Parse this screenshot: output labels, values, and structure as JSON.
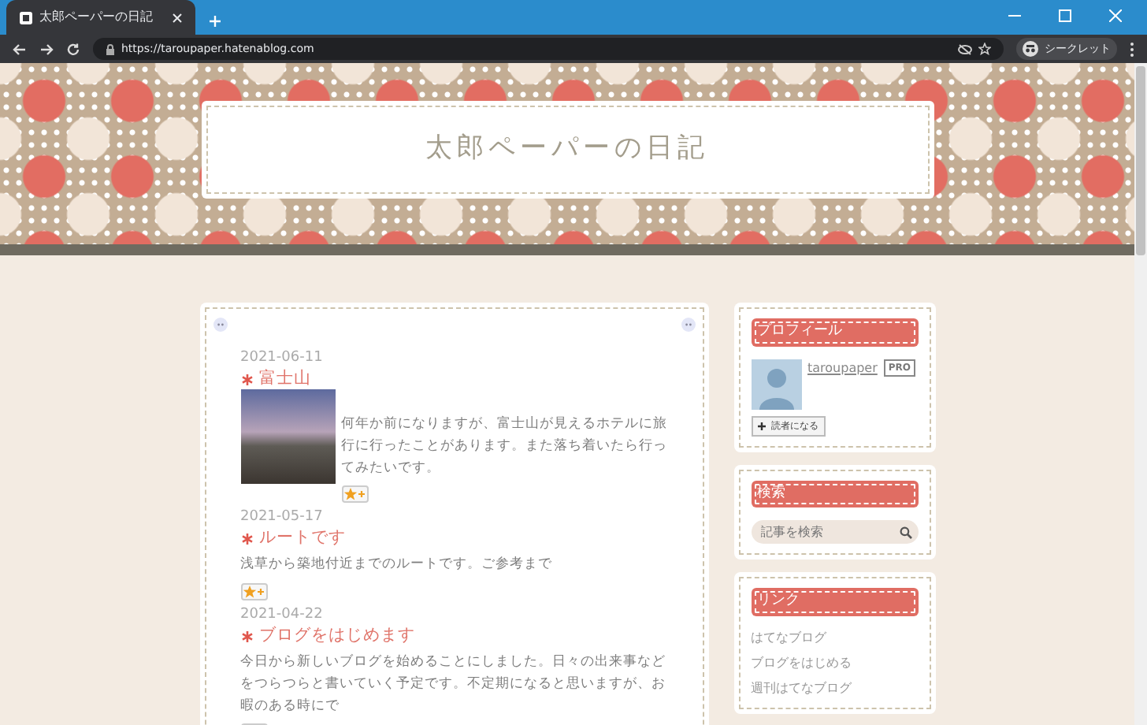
{
  "browser": {
    "tab_title": "太郎ペーパーの日記",
    "url": "https://taroupaper.hatenablog.com",
    "incognito_label": "シークレット"
  },
  "blog": {
    "title": "太郎ペーパーの日記"
  },
  "entries": [
    {
      "date": "2021-06-11",
      "title": "富士山",
      "has_photo": true,
      "body": "何年か前になりますが、富士山が見えるホテルに旅行に行ったことがあります。また落ち着いたら行ってみたいです。"
    },
    {
      "date": "2021-05-17",
      "title": "ルートです",
      "has_photo": false,
      "body": "浅草から築地付近までのルートです。ご参考まで"
    },
    {
      "date": "2021-04-22",
      "title": "ブログをはじめます",
      "has_photo": false,
      "body": "今日から新しいブログを始めることにしました。日々の出来事などをつらつらと書いていく予定です。不定期になると思いますが、お暇のある時にで"
    }
  ],
  "sidebar": {
    "profile": {
      "heading": "プロフィール",
      "username": "taroupaper",
      "badge": "PRO",
      "subscribe_button": "読者になる"
    },
    "search": {
      "heading": "検索",
      "placeholder": "記事を検索"
    },
    "links": {
      "heading": "リンク",
      "items": [
        "はてなブログ",
        "ブログをはじめる",
        "週刊はてなブログ"
      ]
    }
  }
}
